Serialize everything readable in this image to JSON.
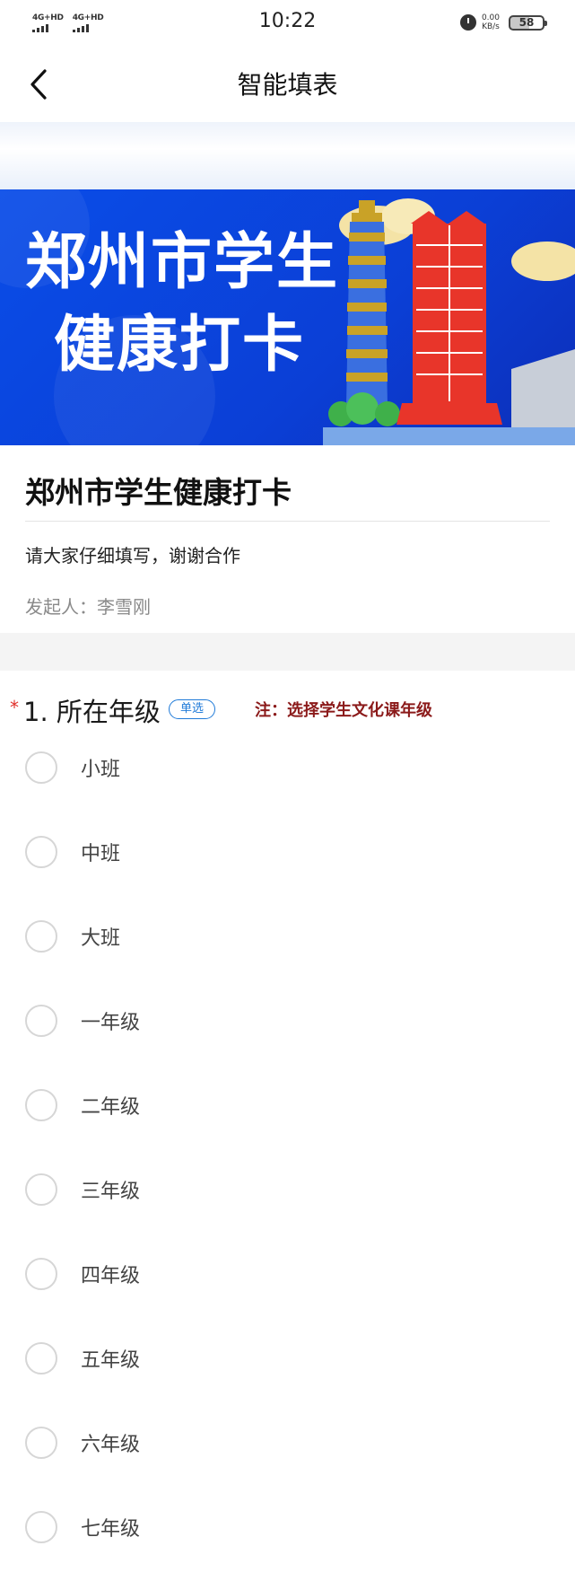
{
  "status_bar": {
    "signal1": "4G+HD",
    "signal2": "4G+HD",
    "time": "10:22",
    "speed_value": "0.00",
    "speed_unit": "KB/s",
    "battery": "58",
    "icons": [
      "alarm-icon",
      "battery-icon",
      "signal-icon"
    ]
  },
  "nav": {
    "title": "智能填表",
    "back_icon": "chevron-left-icon"
  },
  "banner": {
    "line1": "郑州市学生",
    "line2": "健康打卡"
  },
  "form": {
    "title": "郑州市学生健康打卡",
    "description": "请大家仔细填写，谢谢合作",
    "initiator": "发起人：李雪刚"
  },
  "question": {
    "required_mark": "*",
    "title": "1. 所在年级",
    "tag": "单选",
    "note": "注：选择学生文化课年级",
    "options": [
      "小班",
      "中班",
      "大班",
      "一年级",
      "二年级",
      "三年级",
      "四年级",
      "五年级",
      "六年级",
      "七年级"
    ]
  },
  "colors": {
    "banner_blue": "#0b46e0",
    "tag_blue": "#1f7ad8",
    "required_red": "#e0302b",
    "note_red": "#8b1a1a"
  }
}
